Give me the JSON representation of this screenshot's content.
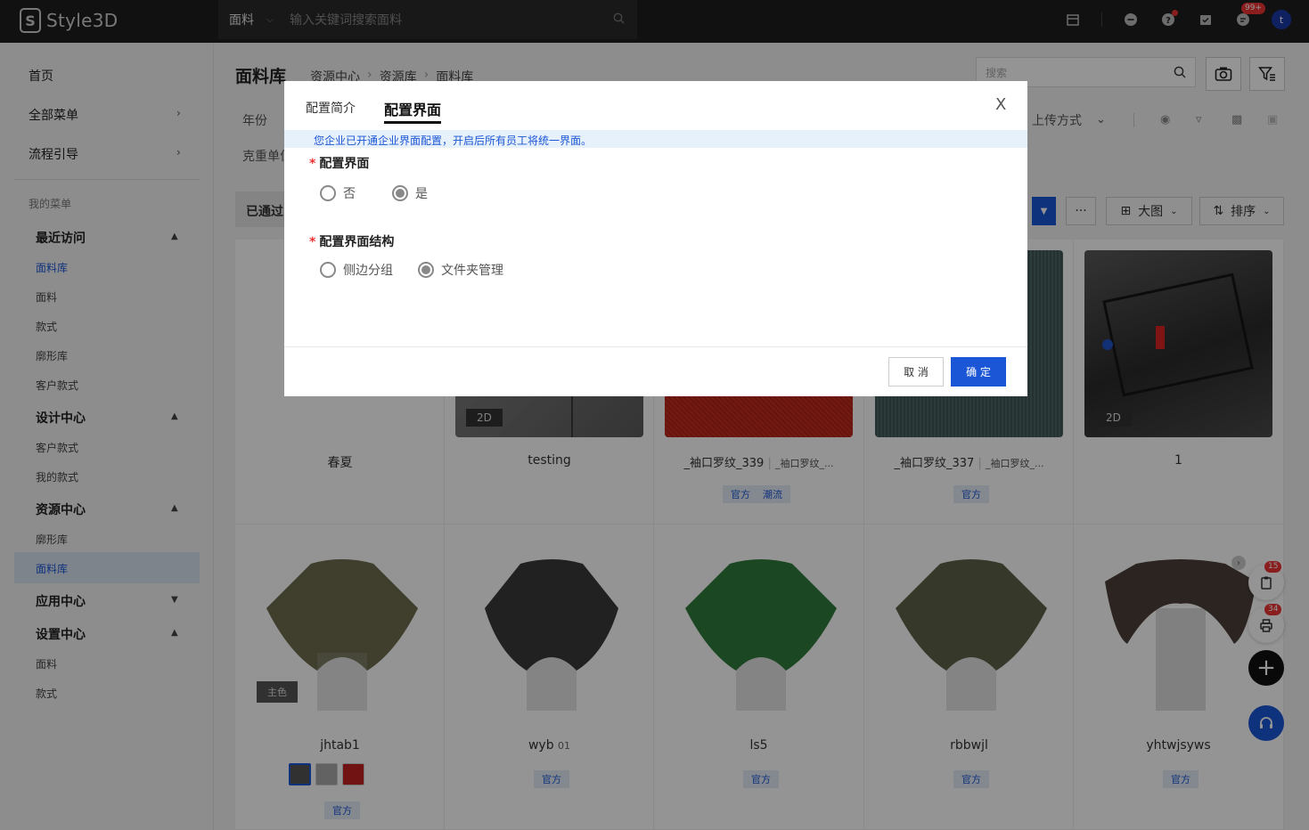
{
  "app": {
    "name": "Style3D"
  },
  "topbar": {
    "search_type": "面料",
    "search_placeholder": "输入关键词搜索面料",
    "message_badge": "99+",
    "avatar_letter": "t"
  },
  "sidebar": {
    "home": "首页",
    "all_menu": "全部菜单",
    "guide": "流程引导",
    "my_menu": "我的菜单",
    "sections": [
      {
        "title": "最近访问",
        "items": [
          "面料库",
          "面料",
          "款式",
          "廓形库",
          "客户款式"
        ]
      },
      {
        "title": "设计中心",
        "items": [
          "客户款式",
          "我的款式"
        ]
      },
      {
        "title": "资源中心",
        "items": [
          "廓形库",
          "面料库"
        ]
      },
      {
        "title": "应用中心",
        "items": []
      },
      {
        "title": "设置中心",
        "items": [
          "面料",
          "款式"
        ]
      }
    ]
  },
  "main": {
    "title": "面料库",
    "breadcrumb": [
      "资源中心",
      "资源库",
      "面料库"
    ],
    "search_placeholder": "搜索",
    "filters": {
      "year": "年份",
      "weight": "克重单位",
      "upload": "上传方式"
    },
    "passed_tab": "已通过",
    "view_label": "大图",
    "sort_label": "排序",
    "more_label": "···"
  },
  "cards": [
    {
      "name": "春夏",
      "tag": "",
      "tags": []
    },
    {
      "name": "testing",
      "tag": "2D",
      "tags": []
    },
    {
      "name": "_袖口罗纹_339",
      "sub": "_袖口罗纹_...",
      "tags": [
        "官方",
        "潮流"
      ]
    },
    {
      "name": "_袖口罗纹_337",
      "sub": "_袖口罗纹_...",
      "tags": [
        "官方"
      ]
    },
    {
      "name": "1",
      "tag": "2D",
      "tags": []
    },
    {
      "name": "jhtab1",
      "tag": "主色",
      "tags": [
        "官方"
      ]
    },
    {
      "name": "wyb",
      "sub": "01",
      "tags": [
        "官方"
      ]
    },
    {
      "name": "ls5",
      "tags": [
        "官方"
      ]
    },
    {
      "name": "rbbwjl",
      "tags": [
        "官方"
      ]
    },
    {
      "name": "yhtwjsyws",
      "tags": [
        "官方"
      ]
    }
  ],
  "floating": {
    "cart_badge": "15",
    "print_badge": "34"
  },
  "modal": {
    "tabs": [
      "配置简介",
      "配置界面"
    ],
    "notice": "您企业已开通企业界面配置，开启后所有员工将统一界面。",
    "field1": {
      "label": "配置界面",
      "options": [
        "否",
        "是"
      ],
      "selected": "是"
    },
    "field2": {
      "label": "配置界面结构",
      "options": [
        "侧边分组",
        "文件夹管理"
      ],
      "selected": "文件夹管理"
    },
    "cancel": "取 消",
    "ok": "确 定",
    "close": "X"
  }
}
